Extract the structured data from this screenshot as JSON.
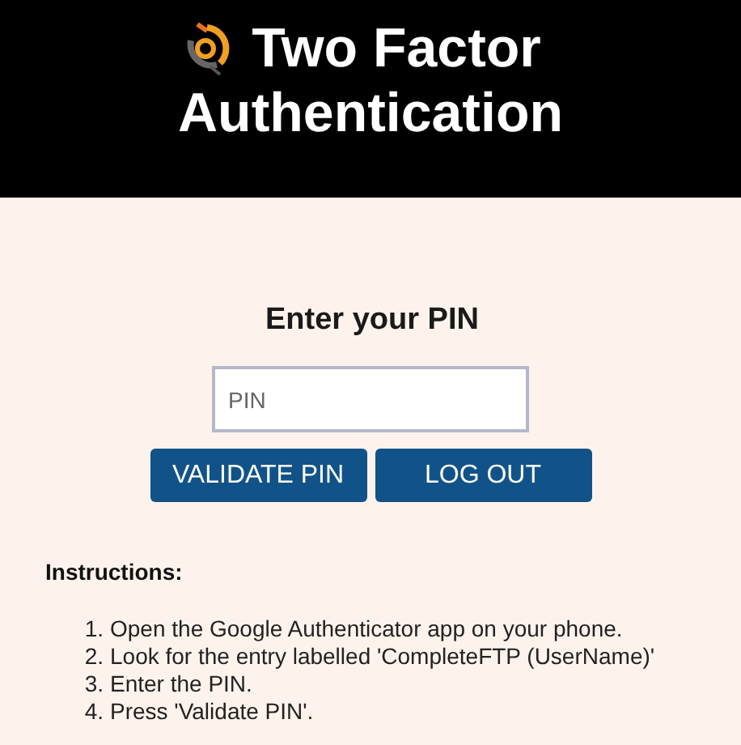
{
  "header": {
    "title_line_1": "Two Factor",
    "title_line_2": "Authentication"
  },
  "form": {
    "heading": "Enter your PIN",
    "pin_field": {
      "placeholder": "PIN"
    },
    "buttons": [
      "VALIDATE PIN",
      "LOG OUT"
    ]
  },
  "instructions": {
    "heading": "Instructions:",
    "steps": [
      {
        "number": "1.",
        "text": "Open the Google Authenticator app on your phone."
      },
      {
        "number": "2.",
        "text": "Look for the entry labelled 'CompleteFTP (UserName)'"
      },
      {
        "number": "3.",
        "text": "Enter the PIN."
      },
      {
        "number": "4.",
        "text": "Press 'Validate PIN'."
      }
    ]
  }
}
